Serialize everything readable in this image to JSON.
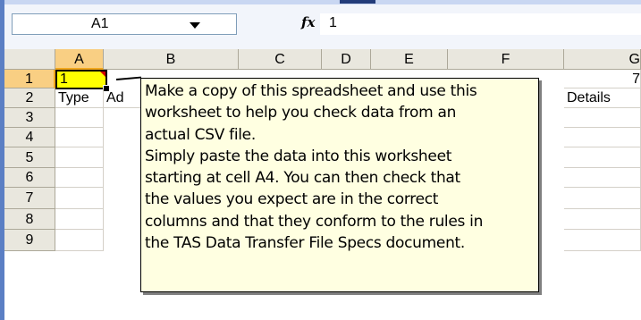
{
  "formula_bar": {
    "name_box": "A1",
    "fx_symbol": "fx",
    "formula_value": "1"
  },
  "columns": [
    "A",
    "B",
    "C",
    "D",
    "E",
    "F",
    "G"
  ],
  "rows": [
    "1",
    "2",
    "3",
    "4",
    "5",
    "6",
    "7",
    "8",
    "9"
  ],
  "cells": {
    "a1": "1",
    "a2": "Type",
    "b2": "Ad",
    "g1": "7",
    "g2": "Details"
  },
  "comment": {
    "lines": [
      "Make a copy of this spreadsheet and use this",
      "worksheet to help you check data from an",
      "actual CSV file.",
      "Simply paste the data into this worksheet",
      "starting at cell A4. You can then check that",
      "the values you expect are in the correct",
      "columns and that they conform to the rules in",
      "the TAS Data Transfer File Specs document."
    ]
  },
  "colors": {
    "selected_cell": "#ffff00",
    "active_header": "#f9cf83",
    "comment_background": "#ffffe1",
    "comment_marker": "#d40000"
  }
}
